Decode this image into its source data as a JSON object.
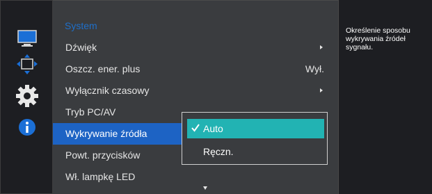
{
  "icons": {
    "picture": "monitor-icon",
    "position": "position-arrows-icon",
    "settings": "gear-icon",
    "info": "info-icon"
  },
  "menu": {
    "title": "System",
    "items": [
      {
        "label": "Dźwięk",
        "value": "",
        "has_submenu": true
      },
      {
        "label": "Oszcz. ener. plus",
        "value": "Wył.",
        "has_submenu": false
      },
      {
        "label": "Wyłącznik czasowy",
        "value": "",
        "has_submenu": true
      },
      {
        "label": "Tryb PC/AV",
        "value": "",
        "has_submenu": false
      },
      {
        "label": "Wykrywanie źródła",
        "value": "",
        "has_submenu": false,
        "active": true
      },
      {
        "label": "Powt. przycisków",
        "value": "",
        "has_submenu": false
      },
      {
        "label": "Wł. lampkę LED",
        "value": "",
        "has_submenu": false
      }
    ]
  },
  "submenu": {
    "options": [
      {
        "label": "Auto",
        "selected": true
      },
      {
        "label": "Ręczn.",
        "selected": false
      }
    ]
  },
  "help": {
    "text": "Określenie sposobu wykrywania źródeł sygnału."
  },
  "colors": {
    "accent_blue": "#1d63c4",
    "selected_teal": "#22b3b3",
    "title_blue": "#1f6fc9"
  }
}
